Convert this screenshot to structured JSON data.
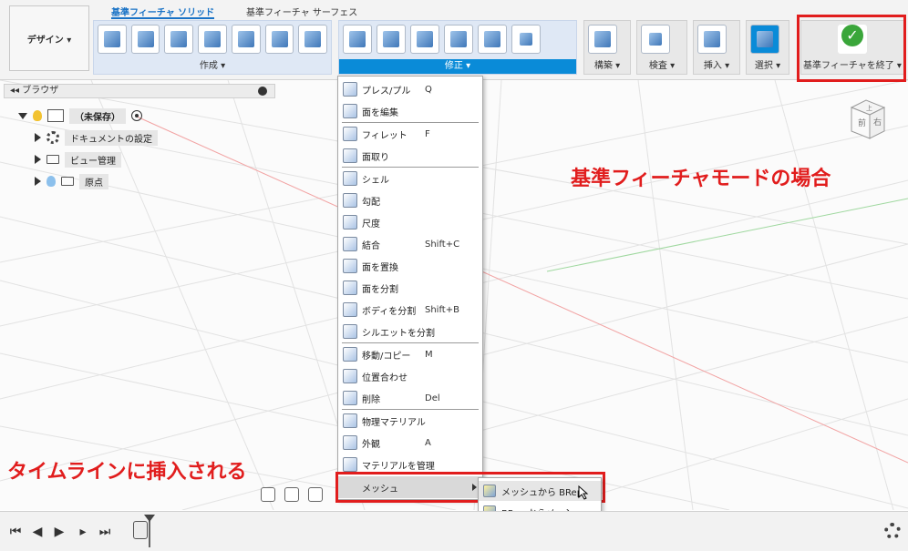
{
  "toolbar": {
    "design_label": "デザイン ▾",
    "tabs": [
      "基準フィーチャ ソリッド",
      "基準フィーチャ サーフェス"
    ],
    "groups": {
      "create": "作成 ▾",
      "modify": "修正 ▾",
      "construct": "構築 ▾",
      "inspect": "検査 ▾",
      "insert": "挿入 ▾",
      "select": "選択 ▾",
      "finish": "基準フィーチャを終了 ▾"
    }
  },
  "browser": {
    "title": "ブラウザ",
    "items": [
      {
        "label": "（未保存）"
      },
      {
        "label": "ドキュメントの設定"
      },
      {
        "label": "ビュー管理"
      },
      {
        "label": "原点"
      }
    ]
  },
  "menu": {
    "items": [
      {
        "label": "プレス/プル",
        "shortcut": "Q"
      },
      {
        "label": "面を編集",
        "shortcut": ""
      },
      {
        "label": "フィレット",
        "shortcut": "F"
      },
      {
        "label": "面取り",
        "shortcut": ""
      },
      {
        "label": "シェル",
        "shortcut": ""
      },
      {
        "label": "勾配",
        "shortcut": ""
      },
      {
        "label": "尺度",
        "shortcut": ""
      },
      {
        "label": "結合",
        "shortcut": "Shift+C"
      },
      {
        "label": "面を置換",
        "shortcut": ""
      },
      {
        "label": "面を分割",
        "shortcut": ""
      },
      {
        "label": "ボディを分割",
        "shortcut": "Shift+B"
      },
      {
        "label": "シルエットを分割",
        "shortcut": ""
      },
      {
        "label": "移動/コピー",
        "shortcut": "M"
      },
      {
        "label": "位置合わせ",
        "shortcut": ""
      },
      {
        "label": "削除",
        "shortcut": "Del"
      },
      {
        "label": "物理マテリアル",
        "shortcut": ""
      },
      {
        "label": "外観",
        "shortcut": "A"
      },
      {
        "label": "マテリアルを管理",
        "shortcut": ""
      },
      {
        "label": "メッシュ",
        "shortcut": ""
      }
    ]
  },
  "submenu": {
    "items": [
      {
        "label": "メッシュから BRep"
      },
      {
        "label": "BRep からメッシュ"
      }
    ]
  },
  "annotations": {
    "mode": "基準フィーチャモードの場合",
    "timeline": "タイムラインに挿入される"
  },
  "viewcube": {
    "front": "前",
    "right": "右",
    "top": "上"
  },
  "colors": {
    "accent": "#0a8bd8",
    "highlight_red": "#e11d1d",
    "check_green": "#3aa63a"
  }
}
